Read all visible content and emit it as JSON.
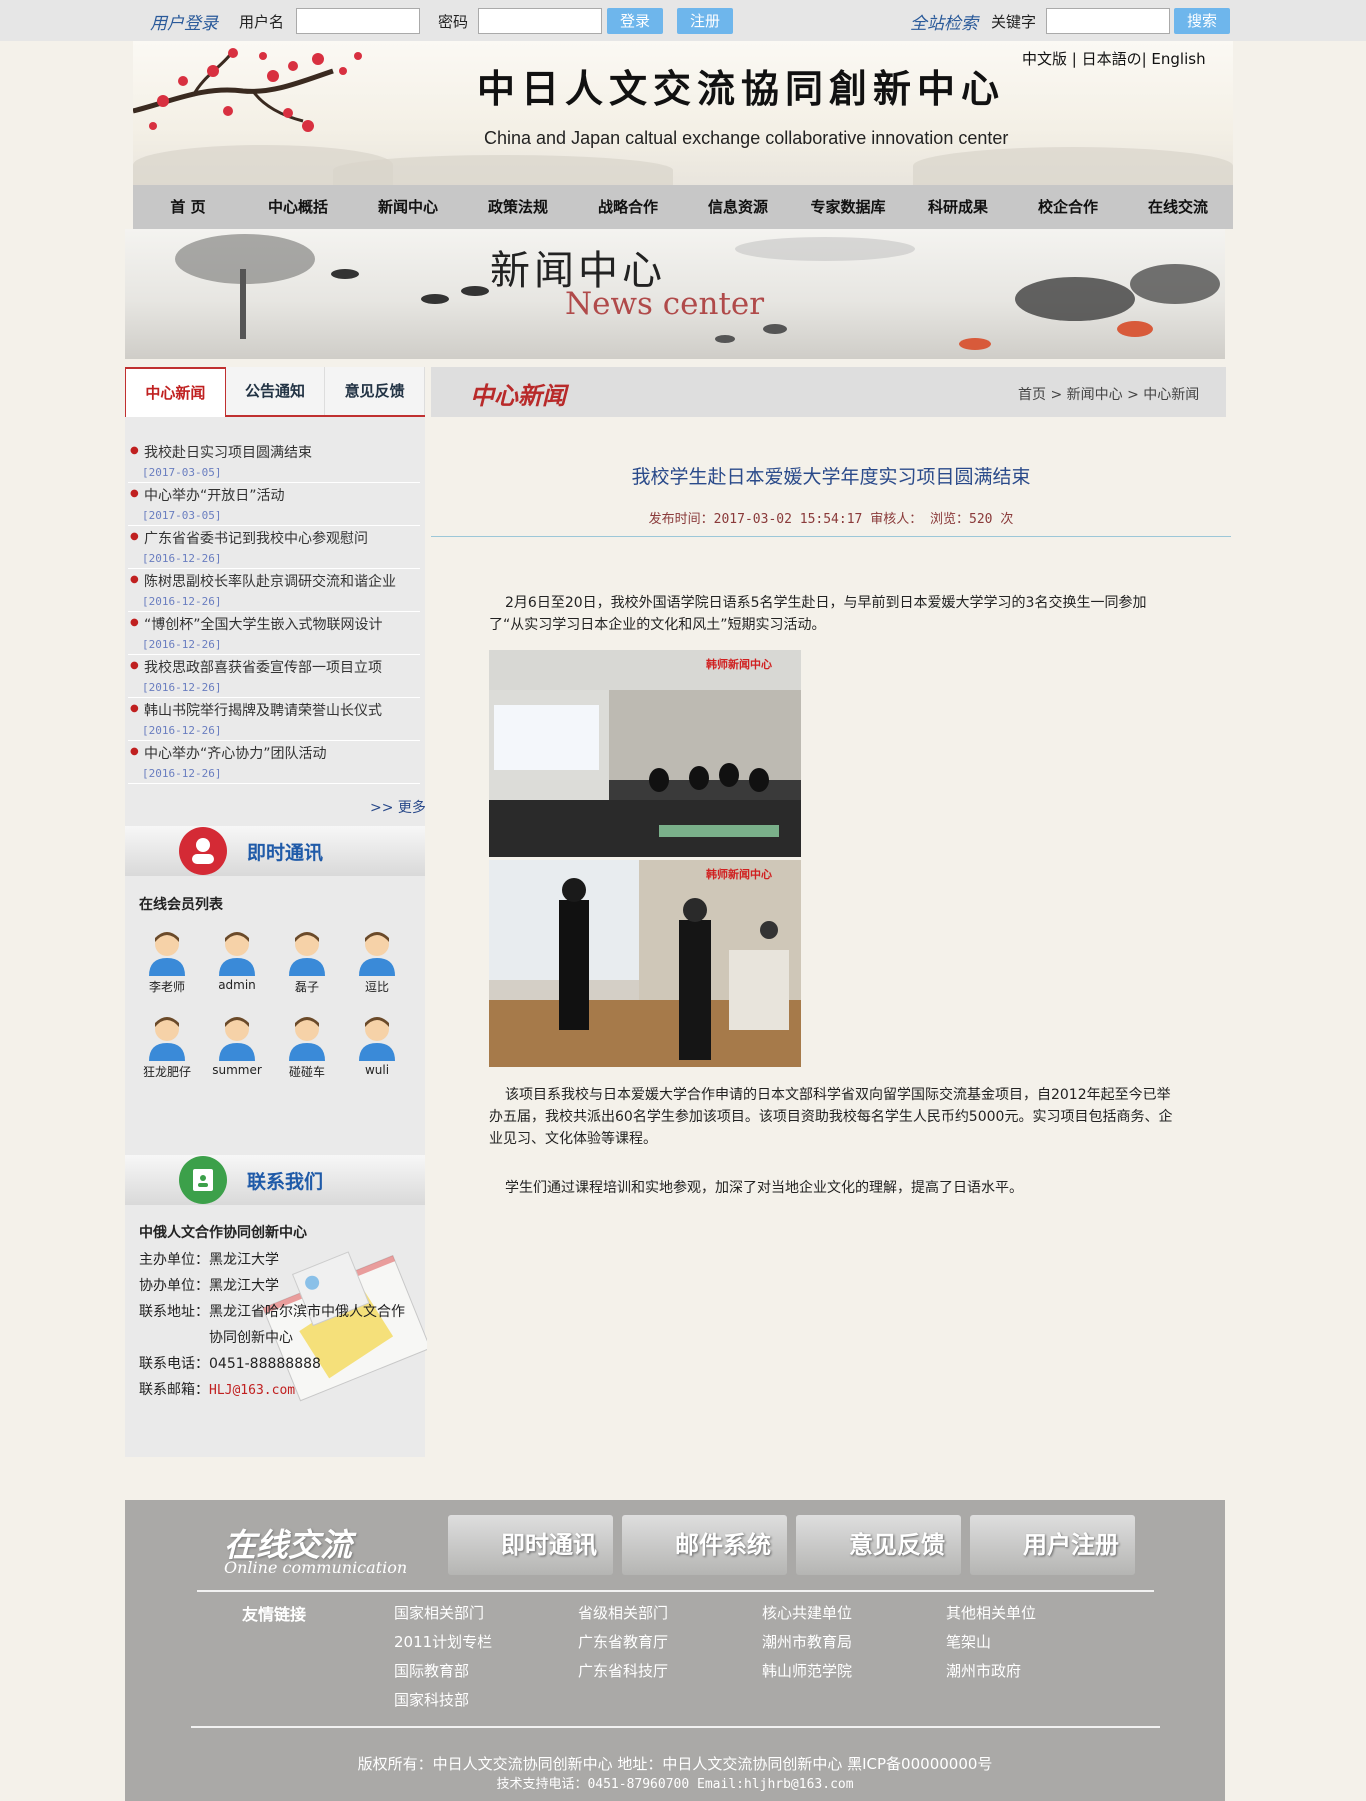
{
  "topbar": {
    "login_label": "用户登录",
    "username_label": "用户名",
    "password_label": "密码",
    "login_btn": "登录",
    "register_btn": "注册",
    "search_label": "全站检索",
    "keyword_label": "关键字",
    "search_btn": "搜索"
  },
  "header": {
    "title": "中日人文交流協同創新中心",
    "subtitle": "China and Japan caltual exchange collaborative innovation center",
    "languages": "中文版 | 日本語の| English"
  },
  "nav": [
    "首  页",
    "中心概括",
    "新闻中心",
    "政策法规",
    "战略合作",
    "信息资源",
    "专家数据库",
    "科研成果",
    "校企合作",
    "在线交流"
  ],
  "banner": {
    "cn": "新闻中心",
    "en": "News center"
  },
  "left_tabs": [
    "中心新闻",
    "公告通知",
    "意见反馈"
  ],
  "news_list": [
    {
      "title": "我校赴日实习项目圆满结束",
      "date": "[2017-03-05]"
    },
    {
      "title": "中心举办“开放日”活动",
      "date": "[2017-03-05]"
    },
    {
      "title": "广东省省委书记到我校中心参观慰问",
      "date": "[2016-12-26]"
    },
    {
      "title": "陈树思副校长率队赴京调研交流和谐企业",
      "date": "[2016-12-26]"
    },
    {
      "title": "“博创杯”全国大学生嵌入式物联网设计",
      "date": "[2016-12-26]"
    },
    {
      "title": "我校思政部喜获省委宣传部一项目立项",
      "date": "[2016-12-26]"
    },
    {
      "title": "韩山书院举行揭牌及聘请荣誉山长仪式",
      "date": "[2016-12-26]"
    },
    {
      "title": "中心举办“齐心协力”团队活动",
      "date": "[2016-12-26]"
    }
  ],
  "more": ">> 更多",
  "im": {
    "title": "即时通讯",
    "list_title": "在线会员列表",
    "members": [
      "李老师",
      "admin",
      "磊子",
      "逗比",
      "狂龙肥仔",
      "summer",
      "碰碰车",
      "wuli"
    ]
  },
  "contact": {
    "title": "联系我们",
    "org": "中俄人文合作协同创新中心",
    "host": "主办单位：黑龙江大学",
    "co": "协办单位：黑龙江大学",
    "addr1": "联系地址：黑龙江省哈尔滨市中俄人文合作",
    "addr2": "协同创新中心",
    "phone": "联系电话：0451-88888888",
    "email_label": "联系邮箱：",
    "email": "HLJ@163.com"
  },
  "main": {
    "section_title": "中心新闻",
    "breadcrumb": "首页 > 新闻中心 > 中心新闻",
    "article_title": "我校学生赴日本爱媛大学年度实习项目圆满结束",
    "meta": "发布时间：2017-03-02 15:54:17 审核人：  浏览：520 次",
    "p1": "2月6日至20日，我校外国语学院日语系5名学生赴日，与早前到日本爱媛大学学习的3名交换生一同参加了“从实习学习日本企业的文化和风土”短期实习活动。",
    "p2": "该项目系我校与日本爱媛大学合作申请的日本文部科学省双向留学国际交流基金项目，自2012年起至今已举办五届，我校共派出60名学生参加该项目。该项目资助我校每名学生人民币约5000元。实习项目包括商务、企业见习、文化体验等课程。",
    "p3": "学生们通过课程培训和实地参观，加深了对当地企业文化的理解，提高了日语水平。",
    "photo_watermark": "韩师新闻中心"
  },
  "footer": {
    "logo_cn": "在线交流",
    "logo_en": "Online communication",
    "buttons": [
      "即时通讯",
      "邮件系统",
      "意见反馈",
      "用户注册"
    ],
    "friend_label": "友情链接",
    "links": [
      [
        "国家相关部门",
        "2011计划专栏",
        "国际教育部",
        "国家科技部"
      ],
      [
        "省级相关部门",
        "广东省教育厅",
        "广东省科技厅"
      ],
      [
        "核心共建单位",
        "潮州市教育局",
        "韩山师范学院"
      ],
      [
        "其他相关单位",
        "笔架山",
        "潮州市政府"
      ]
    ],
    "copyright": "版权所有：中日人文交流协同创新中心  地址：中日人文交流协同创新中心  黑ICP备00000000号",
    "support": "技术支持电话：0451-87960700 Email:hljhrb@163.com"
  },
  "colors": {
    "accent_red": "#c02020",
    "link_blue": "#2a4a8a",
    "topbar_button": "#6eb6ec",
    "footer_bg": "#aaa9a7"
  }
}
